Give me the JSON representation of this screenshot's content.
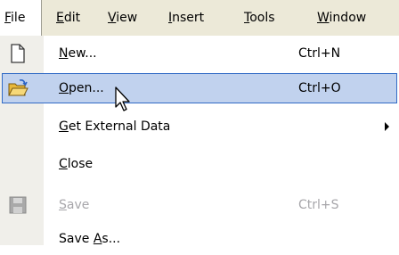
{
  "menubar": {
    "file": {
      "hot": "F",
      "rest": "ile"
    },
    "edit": {
      "hot": "E",
      "rest": "dit"
    },
    "view": {
      "hot": "V",
      "rest": "iew"
    },
    "insert": {
      "hot": "I",
      "rest": "nsert"
    },
    "tools": {
      "hot": "T",
      "rest": "ools"
    },
    "window": {
      "hot": "W",
      "rest": "indow"
    }
  },
  "menu": {
    "new": {
      "hot": "N",
      "rest": "ew...",
      "shortcut": "Ctrl+N",
      "icon": "new-document-icon"
    },
    "open": {
      "hot": "O",
      "rest": "pen...",
      "shortcut": "Ctrl+O",
      "icon": "open-folder-icon"
    },
    "get_external_data": {
      "hot": "G",
      "rest": "et External Data",
      "icon": "submenu-arrow-icon"
    },
    "close": {
      "hot": "C",
      "rest": "lose"
    },
    "save": {
      "hot": "S",
      "rest": "ave",
      "shortcut": "Ctrl+S",
      "icon": "floppy-disk-icon",
      "disabled": true
    },
    "save_as": {
      "pre": "Save ",
      "hot": "A",
      "rest": "s..."
    }
  },
  "colors": {
    "menubar_bg": "#ece9d8",
    "gutter_bg": "#f0efea",
    "highlight_bg": "#c1d2ee",
    "highlight_border": "#316ac5",
    "disabled_text": "#a7a6aa"
  }
}
